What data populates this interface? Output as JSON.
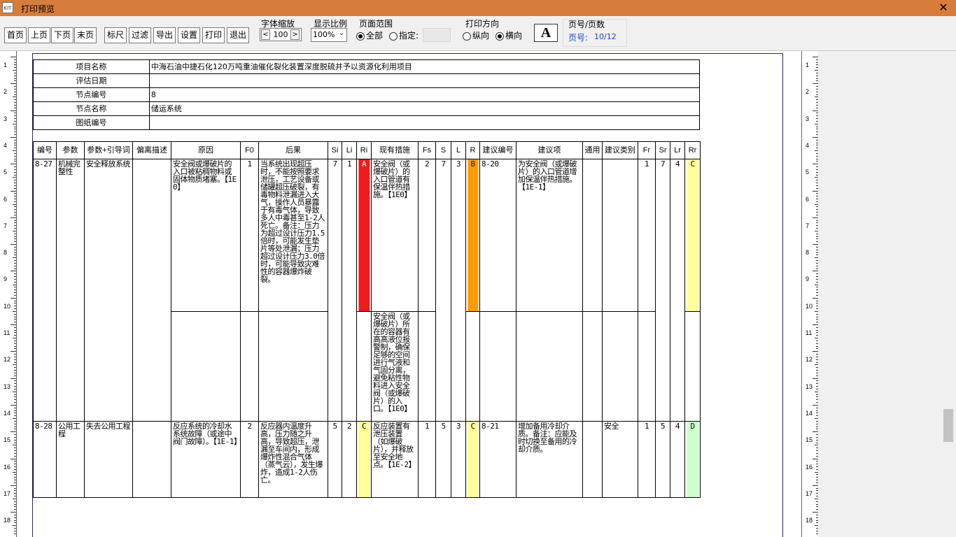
{
  "window": {
    "title": "打印预览",
    "close": "✕"
  },
  "toolbar": {
    "buttons": [
      "首页",
      "上页",
      "下页",
      "末页",
      "标尺",
      "过滤",
      "导出",
      "设置",
      "打印",
      "退出"
    ],
    "font_zoom": {
      "label": "字体缩放",
      "dec": "<",
      "value": "100",
      "inc": ">"
    },
    "display_ratio": {
      "label": "显示比例",
      "value": "100%"
    },
    "page_range": {
      "label": "页面范围",
      "all": "全部",
      "specify": "指定:"
    },
    "print_direction": {
      "label": "打印方向",
      "portrait": "纵向",
      "landscape": "横向"
    },
    "font_icon": "A",
    "page_info": {
      "label": "页号/页数",
      "prefix": "页号:",
      "value": "10/12"
    }
  },
  "ruler": {
    "numbers": [
      "1",
      "2",
      "3",
      "4",
      "5",
      "6",
      "7",
      "8",
      "9",
      "10",
      "11",
      "12",
      "13",
      "14",
      "15",
      "16",
      "17",
      "18"
    ]
  },
  "info_table": [
    {
      "label": "项目名称",
      "value": "中海石油中捷石化120万吨重油催化裂化装置深度脱硫并予以资源化利用项目"
    },
    {
      "label": "评估日期",
      "value": ""
    },
    {
      "label": "节点编号",
      "value": "8"
    },
    {
      "label": "节点名称",
      "value": "储运系统"
    },
    {
      "label": "图纸编号",
      "value": ""
    }
  ],
  "colors": {
    "A": "#ee1c1c",
    "B": "#ff9a00",
    "C": "#ffff99",
    "D": "#ccffcc",
    "C_dark": "#ffff66"
  },
  "main_table": {
    "headers": [
      "编号",
      "参数",
      "参数+引导词",
      "偏离描述",
      "原因",
      "F0",
      "后果",
      "Si",
      "Li",
      "Ri",
      "现有措施",
      "Fs",
      "S",
      "L",
      "R",
      "建议编号",
      "建议项",
      "通用",
      "建议类别",
      "Fr",
      "Sr",
      "Lr",
      "Rr"
    ],
    "rows": [
      {
        "id": "8-27",
        "param": "机械完整性",
        "guide": "安全释放系统",
        "dev": "",
        "cause": "安全阀或爆破片的入口被粘稠物料或固体物质堵塞。【1E0】",
        "f0": "1",
        "conseq": "当系统出现超压时，不能按照要求泄压，工艺设备或储罐超压破裂，有毒物料泄漏进入大气，操作人员暴露于有毒气体，导致多人中毒甚至1-2人死亡。备注：压力为超过设计压力1.5倍时，可能发生垫片等处泄漏；压力超过设计压力3.0倍时，可能导致灾难性的容器爆炸破裂。",
        "si": "7",
        "li": "1",
        "ri": "A",
        "measure1": "安全阀（或爆破片）的入口管道有保温伴热措施。【1E0】",
        "measure2": "安全阀（或爆破片）所在的容器有高高液位报警制，确保足够的空间进行气液和气固分离，避免粘性物料进入安全阀（或爆破片）的入口。【1E0】",
        "fs": "2",
        "s": "7",
        "l": "3",
        "r": "B",
        "sugid": "8-20",
        "sug": "为安全阀（或爆破片）的入口管道增加保温伴热措施。【1E-1】",
        "general": "",
        "cat": "",
        "fr": "1",
        "sr": "7",
        "lr": "4",
        "rr": "C"
      },
      {
        "id": "8-28",
        "param": "公用工程",
        "guide": "失去公用工程",
        "dev": "",
        "cause": "反应系统的冷却水系统故障（或途中阀门故障）。【1E-1】",
        "f0": "2",
        "conseq": "反应器内温度升高，压力随之升高，导致超压，泄漏至车间内，形成爆炸性混合气体（蒸气云），发生爆炸，造成1-2人伤亡。",
        "si": "5",
        "li": "2",
        "ri": "C",
        "measure1": "反应装置有泄压装置（如爆破片），并释放至安全地点。【1E-2】",
        "fs": "1",
        "s": "5",
        "l": "3",
        "r": "C",
        "sugid": "8-21",
        "sug": "增加备用冷却介质。备注：应能及时切换至备用的冷却介质。",
        "general": "",
        "cat": "安全",
        "fr": "1",
        "sr": "5",
        "lr": "4",
        "rr": "D"
      }
    ]
  }
}
